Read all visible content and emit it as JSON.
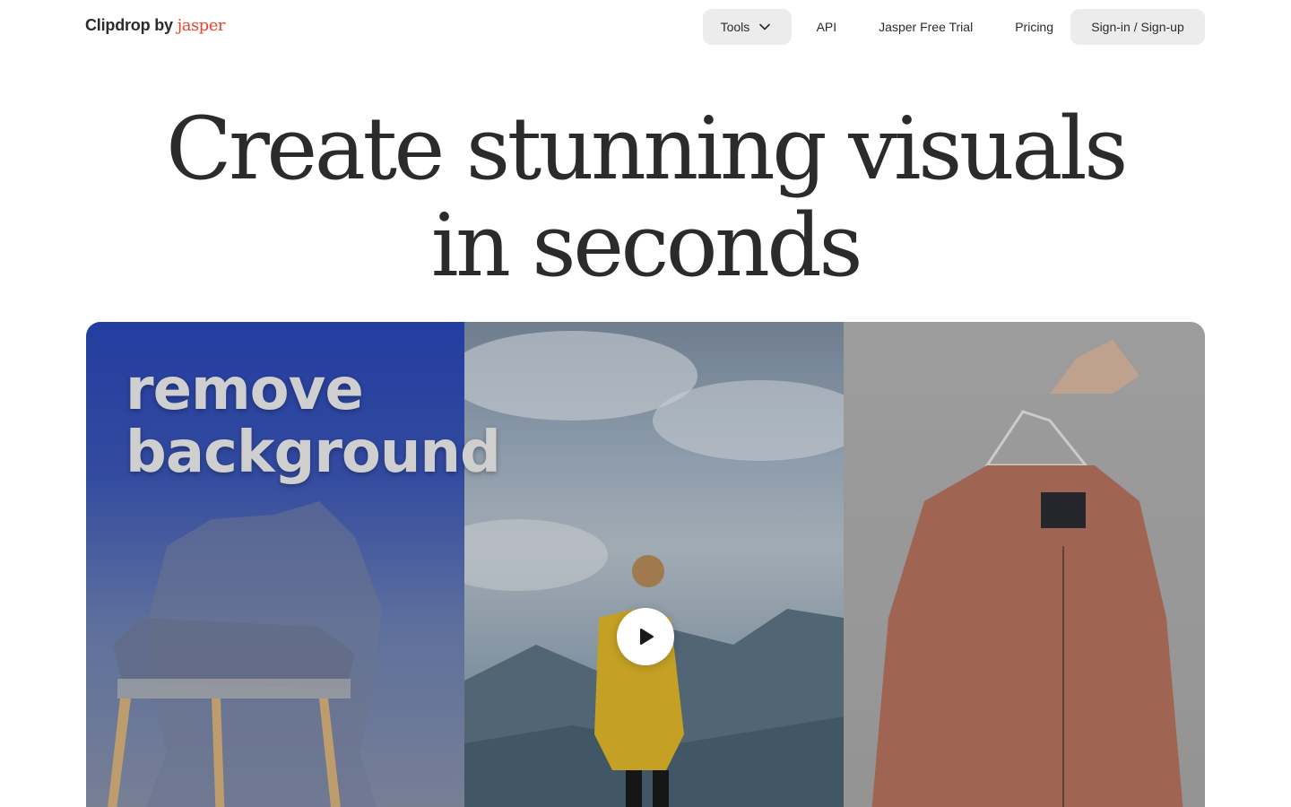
{
  "header": {
    "logo": {
      "name": "Clipdrop",
      "by": "by",
      "brand": "jasper"
    },
    "nav": [
      {
        "label": "Tools"
      },
      {
        "label": "API"
      },
      {
        "label": "Jasper Free Trial"
      },
      {
        "label": "Pricing"
      },
      {
        "label": "Sign-in / Sign-up"
      }
    ]
  },
  "hero": {
    "title_line1": "Create stunning visuals",
    "title_line2": "in seconds"
  },
  "showcase": {
    "overlay_line1": "remove",
    "overlay_line2": "background",
    "play_icon": "play-icon"
  },
  "colors": {
    "brand_accent": "#e8432f",
    "text": "#2b2b2b",
    "button_bg": "#ececec"
  }
}
